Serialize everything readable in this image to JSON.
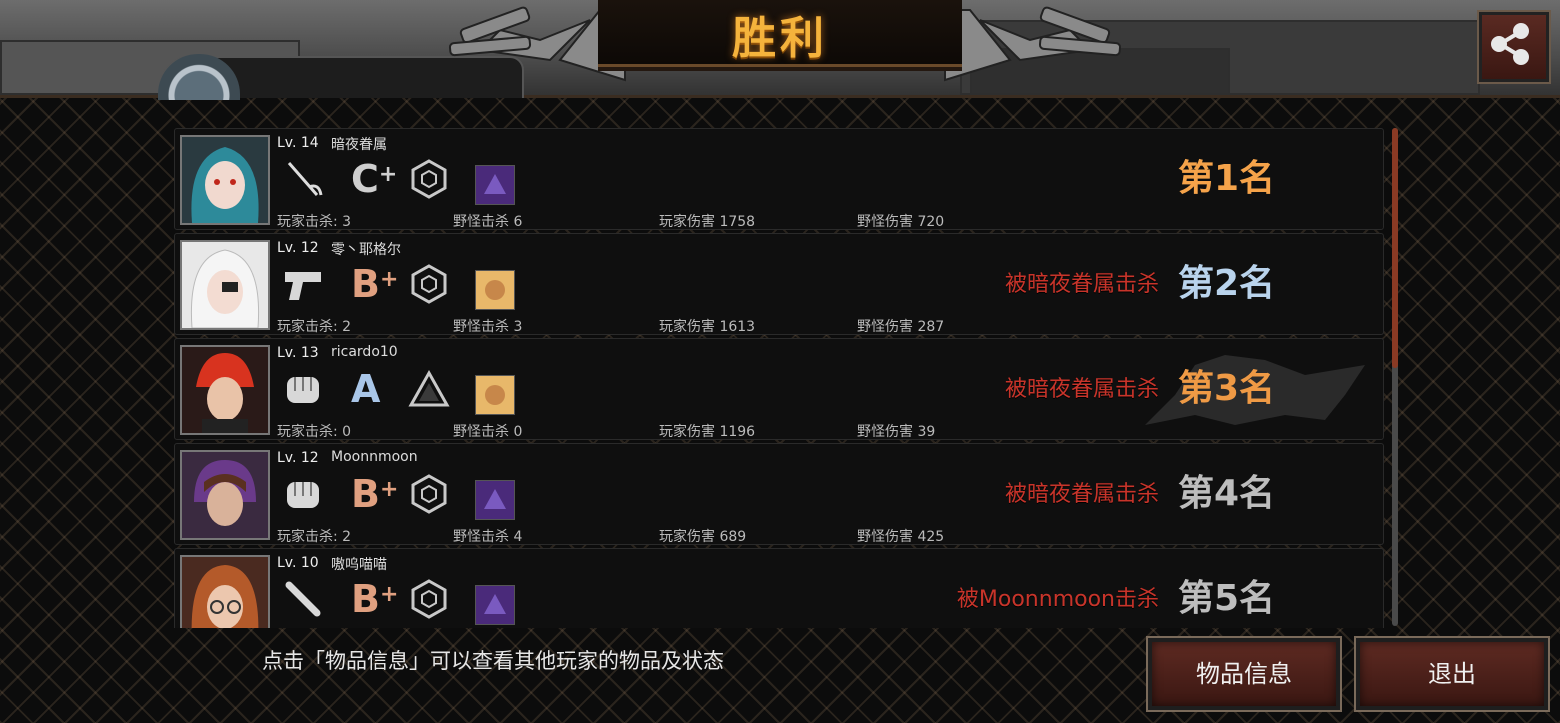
{
  "banner": {
    "title": "胜利"
  },
  "team_tab": {
    "text": ""
  },
  "colors": {
    "gold": "#f5b33c",
    "killed_red": "#c8342a",
    "rank1": "#f5a34a",
    "rank2": "#b9d3ec",
    "rank3": "#ef9a45",
    "rank_default": "#bdbdbd",
    "button_bg": "#5e2a22"
  },
  "players": [
    {
      "level": "Lv. 14",
      "name": "暗夜眷属",
      "weapon_icon": "rapier-icon",
      "grade": "C",
      "grade_plus": "+",
      "emblem_icon": "hexagon-emblem-icon",
      "item_icon": "purple-armor-icon",
      "player_kills": "玩家击杀: 3",
      "monster_kills": "野怪击杀 6",
      "player_damage": "玩家伤害 1758",
      "monster_damage": "野怪伤害 720",
      "killed_by": "",
      "rank": "第1名"
    },
    {
      "level": "Lv. 12",
      "name": "零丶耶格尔",
      "weapon_icon": "pistol-icon",
      "grade": "B",
      "grade_plus": "+",
      "emblem_icon": "hexagon-emblem-icon",
      "item_icon": "gold-item-icon",
      "player_kills": "玩家击杀: 2",
      "monster_kills": "野怪击杀 3",
      "player_damage": "玩家伤害 1613",
      "monster_damage": "野怪伤害 287",
      "killed_by": "被暗夜眷属击杀",
      "rank": "第2名"
    },
    {
      "level": "Lv. 13",
      "name": "ricardo10",
      "weapon_icon": "fist-icon",
      "grade": "A",
      "grade_plus": "",
      "emblem_icon": "triangle-emblem-icon",
      "item_icon": "gold-item-icon",
      "player_kills": "玩家击杀: 0",
      "monster_kills": "野怪击杀 0",
      "player_damage": "玩家伤害 1196",
      "monster_damage": "野怪伤害 39",
      "killed_by": "被暗夜眷属击杀",
      "rank": "第3名"
    },
    {
      "level": "Lv. 12",
      "name": "Moonnmoon",
      "weapon_icon": "fist-icon",
      "grade": "B",
      "grade_plus": "+",
      "emblem_icon": "hexagon-emblem-icon",
      "item_icon": "purple-armor-icon",
      "player_kills": "玩家击杀: 2",
      "monster_kills": "野怪击杀 4",
      "player_damage": "玩家伤害 689",
      "monster_damage": "野怪伤害 425",
      "killed_by": "被暗夜眷属击杀",
      "rank": "第4名"
    },
    {
      "level": "Lv. 10",
      "name": "嗷呜喵喵",
      "weapon_icon": "baseball-bat-icon",
      "grade": "B",
      "grade_plus": "+",
      "emblem_icon": "hexagon-emblem-icon",
      "item_icon": "purple-armor-icon",
      "player_kills": "",
      "monster_kills": "",
      "player_damage": "",
      "monster_damage": "",
      "killed_by": "被Moonnmoon击杀",
      "rank": "第5名"
    }
  ],
  "footer": {
    "hint": "点击「物品信息」可以查看其他玩家的物品及状态",
    "items_button": "物品信息",
    "exit_button": "退出"
  }
}
